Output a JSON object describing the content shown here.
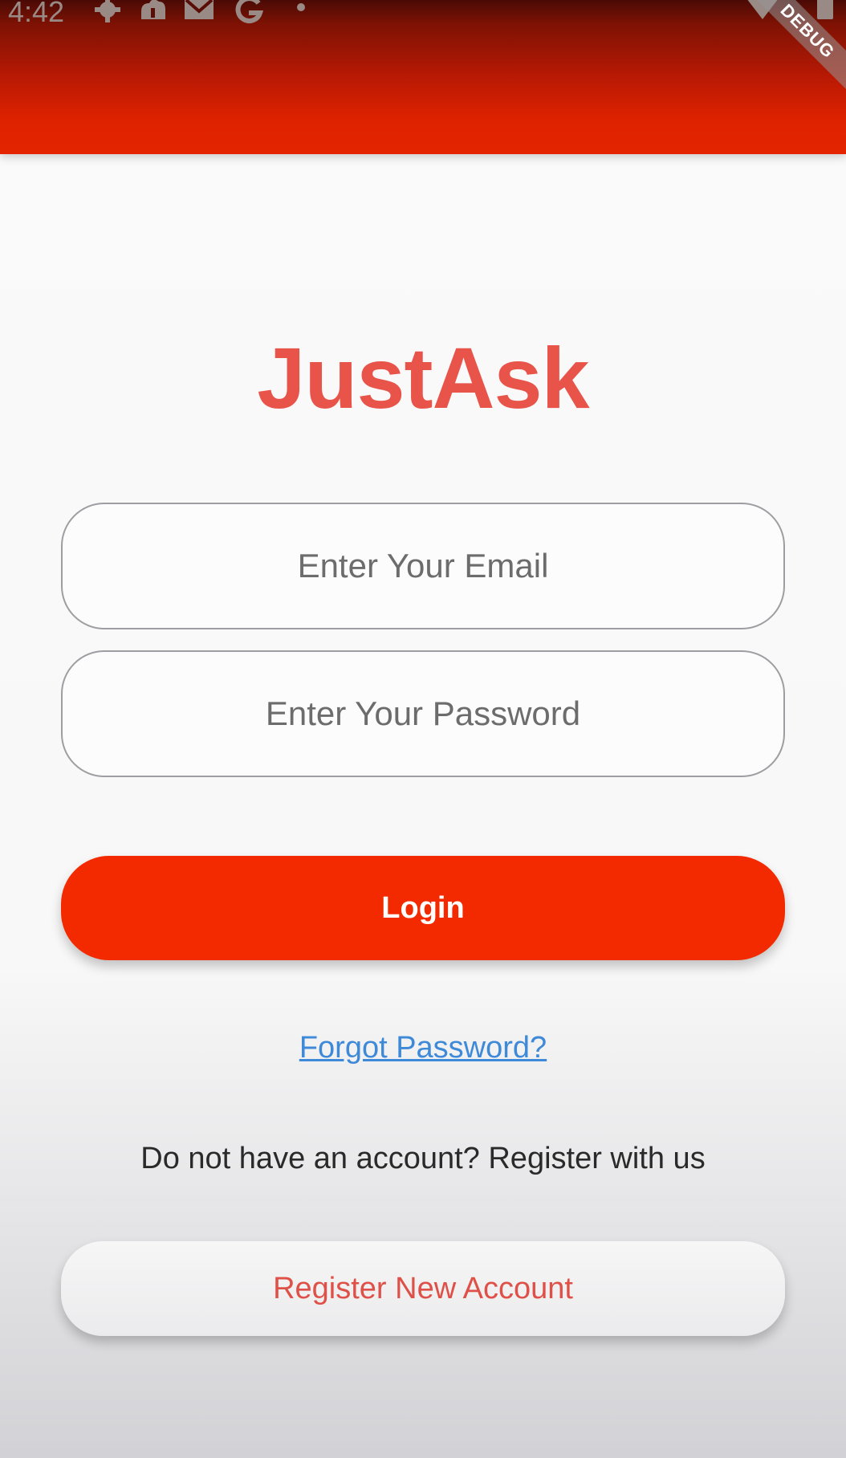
{
  "status_bar": {
    "time": "4:42",
    "icons": [
      "gear-icon",
      "cloud-upload-icon",
      "gmail-icon",
      "google-icon",
      "dot-icon",
      "wifi-icon",
      "battery-icon"
    ]
  },
  "debug_banner": "DEBUG",
  "app": {
    "title": "JustAsk"
  },
  "form": {
    "email_placeholder": "Enter Your Email",
    "password_placeholder": "Enter Your Password",
    "login_label": "Login",
    "forgot_password": "Forgot Password?",
    "register_prompt": "Do not have an account? Register with us",
    "register_label": "Register New Account"
  },
  "colors": {
    "app_bar": "#e42400",
    "title": "#e8544a",
    "login_button": "#f32a00",
    "link": "#3e8ad8",
    "register_text": "#de5048"
  }
}
